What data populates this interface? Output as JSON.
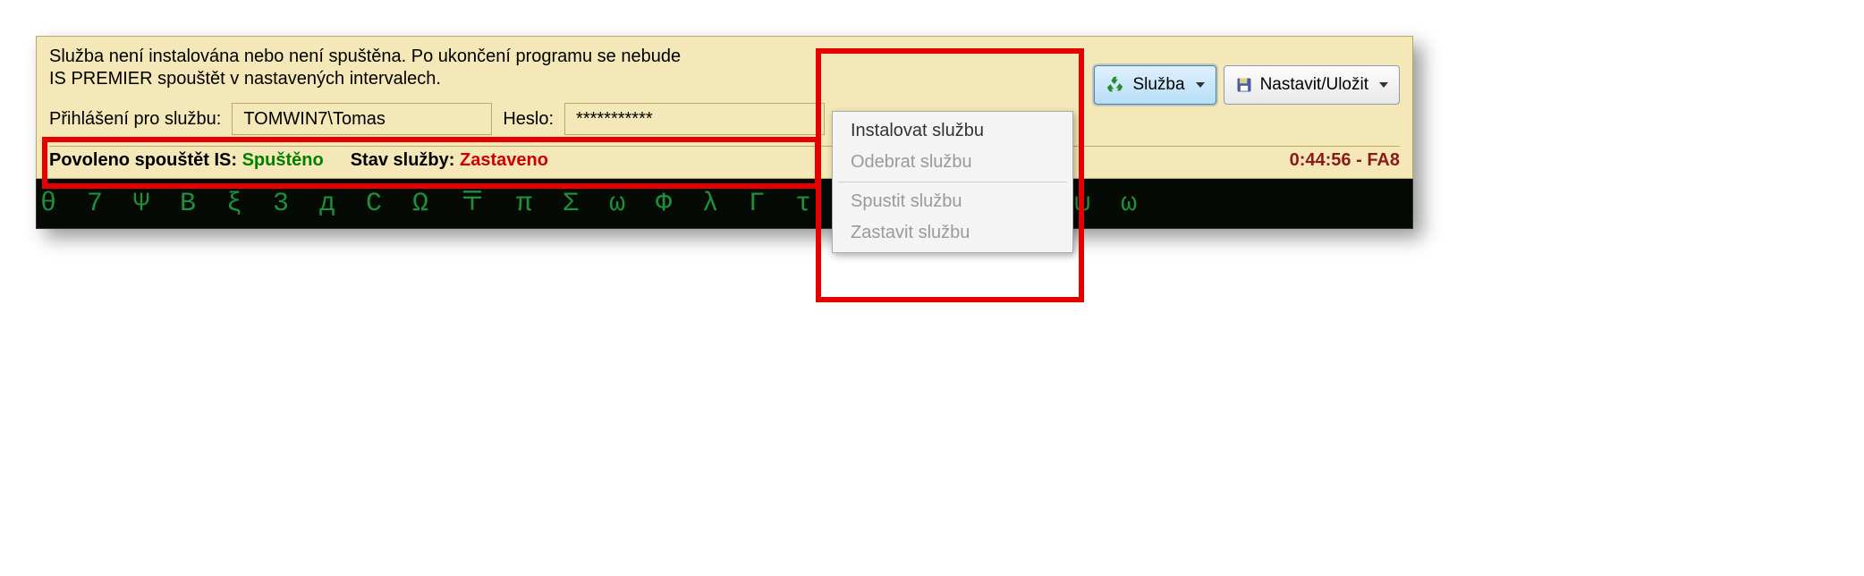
{
  "statusMessage": "Služba není instalována nebo není spuštěna. Po ukončení programu se nebude IS PREMIER spouštět v nastavených intervalech.",
  "buttons": {
    "service": "Služba",
    "saveSet": "Nastavit/Uložit"
  },
  "login": {
    "label": "Přihlášení pro službu:",
    "user": "TOMWIN7\\Tomas",
    "passwordLabel": "Heslo:",
    "passwordMask": "***********"
  },
  "statusBar": {
    "allowedLabel": "Povoleno spouštět IS:",
    "allowedValue": "Spuštěno",
    "serviceStateLabel": "Stav služby:",
    "serviceStateValue": "Zastaveno",
    "timestamp": "0:44:56 - FA8"
  },
  "menu": {
    "install": "Instalovat službu",
    "remove": "Odebrat službu",
    "start": "Spustit službu",
    "stop": "Zastavit službu"
  },
  "matrixDeco": "θ 7 Ψ B ξ 3 д C Ω 〒 π Σ ω Φ λ Г τ φ Д я ж 9 ψ ω"
}
